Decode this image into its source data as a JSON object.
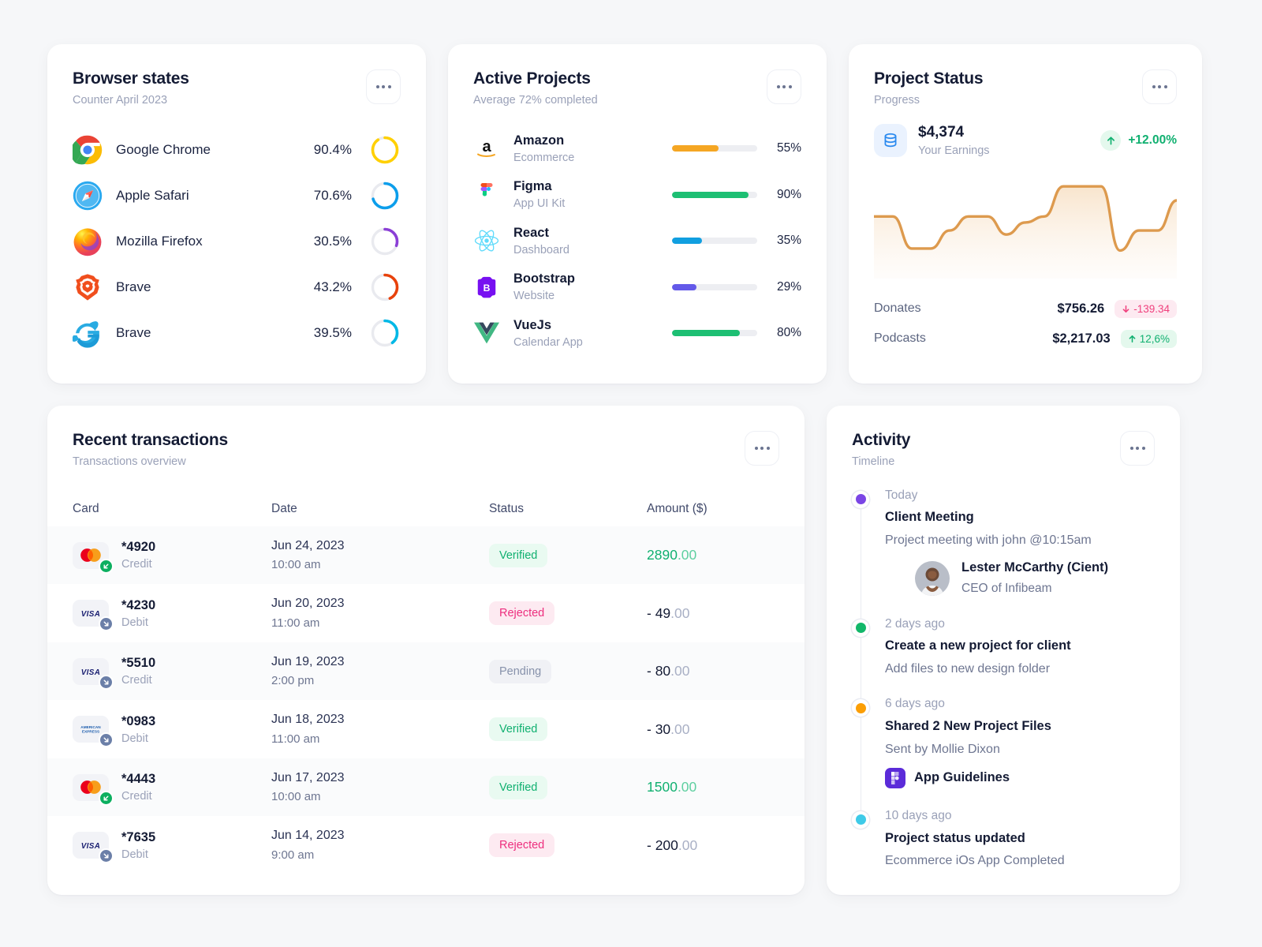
{
  "browser_card": {
    "title": "Browser states",
    "subtitle": "Counter April 2023",
    "menu_label": "more-options",
    "items": [
      {
        "name": "Google Chrome",
        "percent": "90.4%",
        "value": 90.4,
        "icon": "chrome-icon",
        "color": "#FFD000"
      },
      {
        "name": "Apple Safari",
        "percent": "70.6%",
        "value": 70.6,
        "icon": "safari-icon",
        "color": "#0C9EEB"
      },
      {
        "name": "Mozilla Firefox",
        "percent": "30.5%",
        "value": 30.5,
        "icon": "firefox-icon",
        "color": "#8B3FD6"
      },
      {
        "name": "Brave",
        "percent": "43.2%",
        "value": 43.2,
        "icon": "brave-icon",
        "color": "#E8420B"
      },
      {
        "name": "Brave",
        "percent": "39.5%",
        "value": 39.5,
        "icon": "internet-explorer-icon",
        "color": "#00B8E6"
      }
    ]
  },
  "projects_card": {
    "title": "Active Projects",
    "subtitle": "Average 72% completed",
    "items": [
      {
        "name": "Amazon",
        "sub": "Ecommerce",
        "percent": "55%",
        "value": 55,
        "icon": "amazon-icon",
        "color": "#F5A623"
      },
      {
        "name": "Figma",
        "sub": "App UI Kit",
        "percent": "90%",
        "value": 90,
        "icon": "figma-icon",
        "color": "#1DBF73"
      },
      {
        "name": "React",
        "sub": "Dashboard",
        "percent": "35%",
        "value": 35,
        "icon": "react-icon",
        "color": "#119FE0"
      },
      {
        "name": "Bootstrap",
        "sub": "Website",
        "percent": "29%",
        "value": 29,
        "icon": "bootstrap-icon",
        "color": "#6359E9"
      },
      {
        "name": "VueJs",
        "sub": "Calendar App",
        "percent": "80%",
        "value": 80,
        "icon": "vuejs-icon",
        "color": "#1DBF73"
      }
    ]
  },
  "status_card": {
    "title": "Project Status",
    "subtitle": "Progress",
    "earnings_amount": "$4,374",
    "earnings_label": "Your Earnings",
    "earnings_change": "+12.00%",
    "earnings_change_direction": "up",
    "stats": [
      {
        "name": "Donates",
        "value": "$756.26",
        "change": "-139.34",
        "direction": "down"
      },
      {
        "name": "Podcasts",
        "value": "$2,217.03",
        "change": "12,6%",
        "direction": "up"
      }
    ],
    "chart_data": {
      "type": "area",
      "title": "Project Status",
      "line_color": "#DD9A4E",
      "fill_color": "#FBF0E3",
      "xlabel": "",
      "ylabel": "",
      "grid": false,
      "legend": "none",
      "x": [
        0,
        1,
        2,
        3,
        4,
        5,
        6,
        7,
        8,
        9,
        10,
        11,
        12,
        13,
        14,
        15
      ],
      "values": [
        62,
        62,
        30,
        30,
        48,
        62,
        62,
        44,
        56,
        62,
        92,
        92,
        92,
        28,
        48,
        48,
        78
      ]
    }
  },
  "transactions_card": {
    "title": "Recent transactions",
    "subtitle": "Transactions overview",
    "columns": [
      "Card",
      "Date",
      "Status",
      "Amount ($)"
    ],
    "rows": [
      {
        "card": "*4920",
        "card_type": "Credit",
        "brand": "mastercard-icon",
        "direction": "in",
        "date": "Jun 24, 2023",
        "time": "10:00 am",
        "status": "Verified",
        "status_kind": "verified",
        "amount_int": "2890",
        "amount_cents": ".00",
        "positive": true,
        "shade": "tint"
      },
      {
        "card": "*4230",
        "card_type": "Debit",
        "brand": "visa-icon",
        "direction": "out",
        "date": "Jun 20, 2023",
        "time": "11:00 am",
        "status": "Rejected",
        "status_kind": "rejected",
        "amount_int": "- 49",
        "amount_cents": ".00",
        "positive": false,
        "shade": "white"
      },
      {
        "card": "*5510",
        "card_type": "Credit",
        "brand": "visa-icon",
        "direction": "out",
        "date": "Jun 19, 2023",
        "time": "2:00 pm",
        "status": "Pending",
        "status_kind": "pending",
        "amount_int": "- 80",
        "amount_cents": ".00",
        "positive": false,
        "shade": "tint"
      },
      {
        "card": "*0983",
        "card_type": "Debit",
        "brand": "amex-icon",
        "direction": "out",
        "date": "Jun 18, 2023",
        "time": "11:00 am",
        "status": "Verified",
        "status_kind": "verified",
        "amount_int": "- 30",
        "amount_cents": ".00",
        "positive": false,
        "shade": "white"
      },
      {
        "card": "*4443",
        "card_type": "Credit",
        "brand": "mastercard-icon",
        "direction": "in",
        "date": "Jun 17, 2023",
        "time": "10:00 am",
        "status": "Verified",
        "status_kind": "verified",
        "amount_int": "1500",
        "amount_cents": ".00",
        "positive": true,
        "shade": "tint"
      },
      {
        "card": "*7635",
        "card_type": "Debit",
        "brand": "visa-icon",
        "direction": "out",
        "date": "Jun 14, 2023",
        "time": "9:00 am",
        "status": "Rejected",
        "status_kind": "rejected",
        "amount_int": "- 200",
        "amount_cents": ".00",
        "positive": false,
        "shade": "white"
      }
    ]
  },
  "activity_card": {
    "title": "Activity",
    "subtitle": "Timeline",
    "items": [
      {
        "time": "Today",
        "title": "Client Meeting",
        "desc": "Project meeting with john @10:15am",
        "dot_color": "#7A45E5",
        "person_name": "Lester McCarthy (Cient)",
        "person_role": "CEO of Infibeam"
      },
      {
        "time": "2 days ago",
        "title": "Create a new project for client",
        "desc": "Add files to new design folder",
        "dot_color": "#12B76A"
      },
      {
        "time": "6 days ago",
        "title": "Shared 2 New Project Files",
        "desc": "Sent by Mollie Dixon",
        "dot_color": "#FB9E05",
        "file_name": "App Guidelines",
        "file_icon": "figma-file-icon"
      },
      {
        "time": "10 days ago",
        "title": "Project status updated",
        "desc": "Ecommerce iOs App Completed",
        "dot_color": "#3ECAE8"
      }
    ]
  }
}
